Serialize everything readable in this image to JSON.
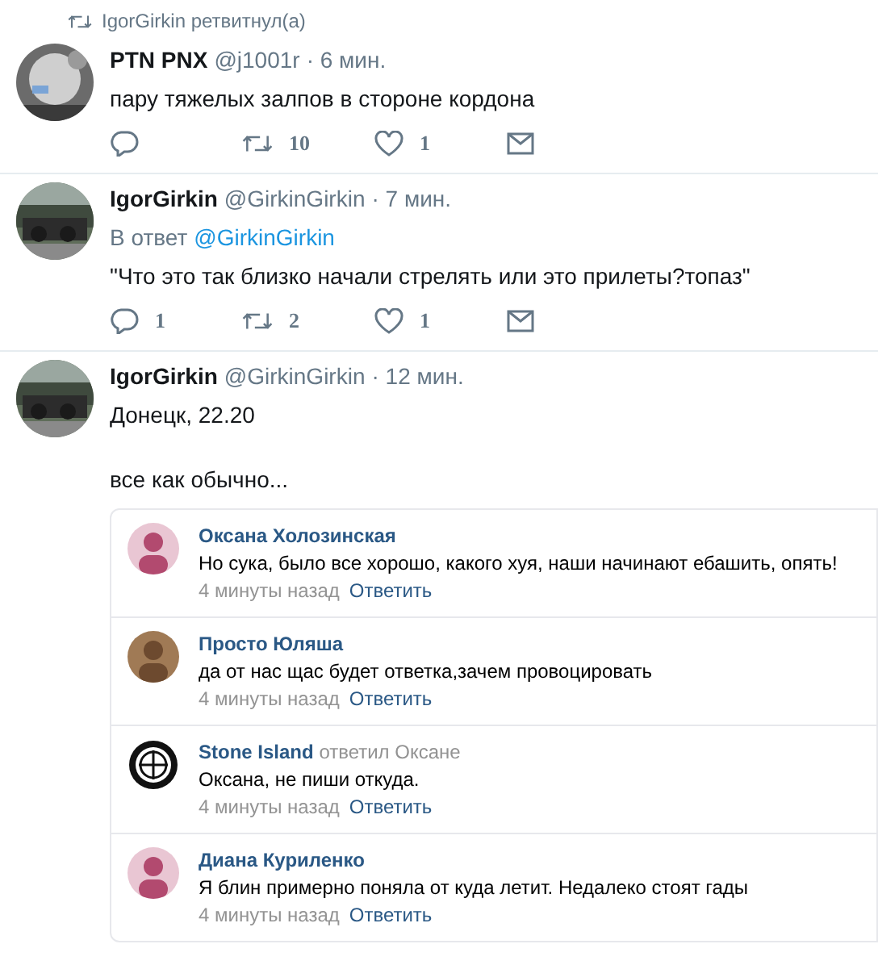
{
  "retweet_note": "IgorGirkin ретвитнул(а)",
  "tweets": [
    {
      "name": "PTN PNX",
      "handle": "@j1001r",
      "time": "· 6 мин.",
      "texts": [
        "пару тяжелых залпов в стороне кордона"
      ],
      "actions": {
        "retweets": "10",
        "likes": "1"
      }
    },
    {
      "name": "IgorGirkin",
      "handle": "@GirkinGirkin",
      "time": "· 7 мин.",
      "reply_to": {
        "prefix": "В ответ",
        "handle": "@GirkinGirkin"
      },
      "texts": [
        "\"Что это так близко начали стрелять или это прилеты?топаз\""
      ],
      "actions": {
        "replies": "1",
        "retweets": "2",
        "likes": "1"
      }
    },
    {
      "name": "IgorGirkin",
      "handle": "@GirkinGirkin",
      "time": "· 12 мин.",
      "texts": [
        "Донецк, 22.20",
        "все как обычно..."
      ],
      "comments": [
        {
          "author": "Оксана Холозинская",
          "kind": "picture",
          "text": "Но сука, было все хорошо, какого хуя, наши начинают ебашить, опять!",
          "time": "4 минуты назад",
          "reply_link": "Ответить"
        },
        {
          "author": "Просто Юляша",
          "kind": "picture",
          "text": "да от нас щас будет ответка,зачем провоцировать",
          "time": "4 минуты назад",
          "reply_link": "Ответить"
        },
        {
          "author": "Stone Island",
          "kind": "emblem",
          "replied_to": "ответил Оксане",
          "text": "Оксана, не пиши откуда.",
          "time": "4 минуты назад",
          "reply_link": "Ответить"
        },
        {
          "author": "Диана Куриленко",
          "kind": "picture",
          "text": "Я блин примерно поняла от куда летит. Недалеко стоят гады",
          "time": "4 минуты назад",
          "reply_link": "Ответить"
        }
      ]
    }
  ]
}
